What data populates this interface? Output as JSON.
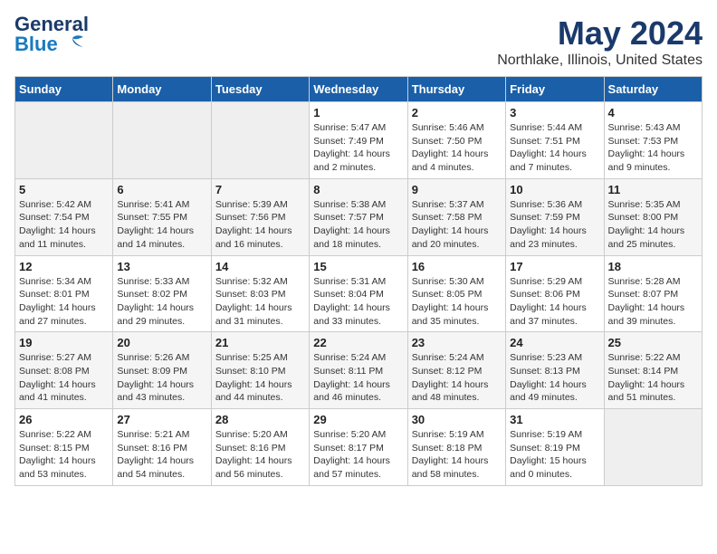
{
  "header": {
    "logo_line1": "General",
    "logo_line2": "Blue",
    "title": "May 2024",
    "subtitle": "Northlake, Illinois, United States"
  },
  "weekdays": [
    "Sunday",
    "Monday",
    "Tuesday",
    "Wednesday",
    "Thursday",
    "Friday",
    "Saturday"
  ],
  "weeks": [
    [
      {
        "day": "",
        "info": ""
      },
      {
        "day": "",
        "info": ""
      },
      {
        "day": "",
        "info": ""
      },
      {
        "day": "1",
        "info": "Sunrise: 5:47 AM\nSunset: 7:49 PM\nDaylight: 14 hours\nand 2 minutes."
      },
      {
        "day": "2",
        "info": "Sunrise: 5:46 AM\nSunset: 7:50 PM\nDaylight: 14 hours\nand 4 minutes."
      },
      {
        "day": "3",
        "info": "Sunrise: 5:44 AM\nSunset: 7:51 PM\nDaylight: 14 hours\nand 7 minutes."
      },
      {
        "day": "4",
        "info": "Sunrise: 5:43 AM\nSunset: 7:53 PM\nDaylight: 14 hours\nand 9 minutes."
      }
    ],
    [
      {
        "day": "5",
        "info": "Sunrise: 5:42 AM\nSunset: 7:54 PM\nDaylight: 14 hours\nand 11 minutes."
      },
      {
        "day": "6",
        "info": "Sunrise: 5:41 AM\nSunset: 7:55 PM\nDaylight: 14 hours\nand 14 minutes."
      },
      {
        "day": "7",
        "info": "Sunrise: 5:39 AM\nSunset: 7:56 PM\nDaylight: 14 hours\nand 16 minutes."
      },
      {
        "day": "8",
        "info": "Sunrise: 5:38 AM\nSunset: 7:57 PM\nDaylight: 14 hours\nand 18 minutes."
      },
      {
        "day": "9",
        "info": "Sunrise: 5:37 AM\nSunset: 7:58 PM\nDaylight: 14 hours\nand 20 minutes."
      },
      {
        "day": "10",
        "info": "Sunrise: 5:36 AM\nSunset: 7:59 PM\nDaylight: 14 hours\nand 23 minutes."
      },
      {
        "day": "11",
        "info": "Sunrise: 5:35 AM\nSunset: 8:00 PM\nDaylight: 14 hours\nand 25 minutes."
      }
    ],
    [
      {
        "day": "12",
        "info": "Sunrise: 5:34 AM\nSunset: 8:01 PM\nDaylight: 14 hours\nand 27 minutes."
      },
      {
        "day": "13",
        "info": "Sunrise: 5:33 AM\nSunset: 8:02 PM\nDaylight: 14 hours\nand 29 minutes."
      },
      {
        "day": "14",
        "info": "Sunrise: 5:32 AM\nSunset: 8:03 PM\nDaylight: 14 hours\nand 31 minutes."
      },
      {
        "day": "15",
        "info": "Sunrise: 5:31 AM\nSunset: 8:04 PM\nDaylight: 14 hours\nand 33 minutes."
      },
      {
        "day": "16",
        "info": "Sunrise: 5:30 AM\nSunset: 8:05 PM\nDaylight: 14 hours\nand 35 minutes."
      },
      {
        "day": "17",
        "info": "Sunrise: 5:29 AM\nSunset: 8:06 PM\nDaylight: 14 hours\nand 37 minutes."
      },
      {
        "day": "18",
        "info": "Sunrise: 5:28 AM\nSunset: 8:07 PM\nDaylight: 14 hours\nand 39 minutes."
      }
    ],
    [
      {
        "day": "19",
        "info": "Sunrise: 5:27 AM\nSunset: 8:08 PM\nDaylight: 14 hours\nand 41 minutes."
      },
      {
        "day": "20",
        "info": "Sunrise: 5:26 AM\nSunset: 8:09 PM\nDaylight: 14 hours\nand 43 minutes."
      },
      {
        "day": "21",
        "info": "Sunrise: 5:25 AM\nSunset: 8:10 PM\nDaylight: 14 hours\nand 44 minutes."
      },
      {
        "day": "22",
        "info": "Sunrise: 5:24 AM\nSunset: 8:11 PM\nDaylight: 14 hours\nand 46 minutes."
      },
      {
        "day": "23",
        "info": "Sunrise: 5:24 AM\nSunset: 8:12 PM\nDaylight: 14 hours\nand 48 minutes."
      },
      {
        "day": "24",
        "info": "Sunrise: 5:23 AM\nSunset: 8:13 PM\nDaylight: 14 hours\nand 49 minutes."
      },
      {
        "day": "25",
        "info": "Sunrise: 5:22 AM\nSunset: 8:14 PM\nDaylight: 14 hours\nand 51 minutes."
      }
    ],
    [
      {
        "day": "26",
        "info": "Sunrise: 5:22 AM\nSunset: 8:15 PM\nDaylight: 14 hours\nand 53 minutes."
      },
      {
        "day": "27",
        "info": "Sunrise: 5:21 AM\nSunset: 8:16 PM\nDaylight: 14 hours\nand 54 minutes."
      },
      {
        "day": "28",
        "info": "Sunrise: 5:20 AM\nSunset: 8:16 PM\nDaylight: 14 hours\nand 56 minutes."
      },
      {
        "day": "29",
        "info": "Sunrise: 5:20 AM\nSunset: 8:17 PM\nDaylight: 14 hours\nand 57 minutes."
      },
      {
        "day": "30",
        "info": "Sunrise: 5:19 AM\nSunset: 8:18 PM\nDaylight: 14 hours\nand 58 minutes."
      },
      {
        "day": "31",
        "info": "Sunrise: 5:19 AM\nSunset: 8:19 PM\nDaylight: 15 hours\nand 0 minutes."
      },
      {
        "day": "",
        "info": ""
      }
    ]
  ]
}
